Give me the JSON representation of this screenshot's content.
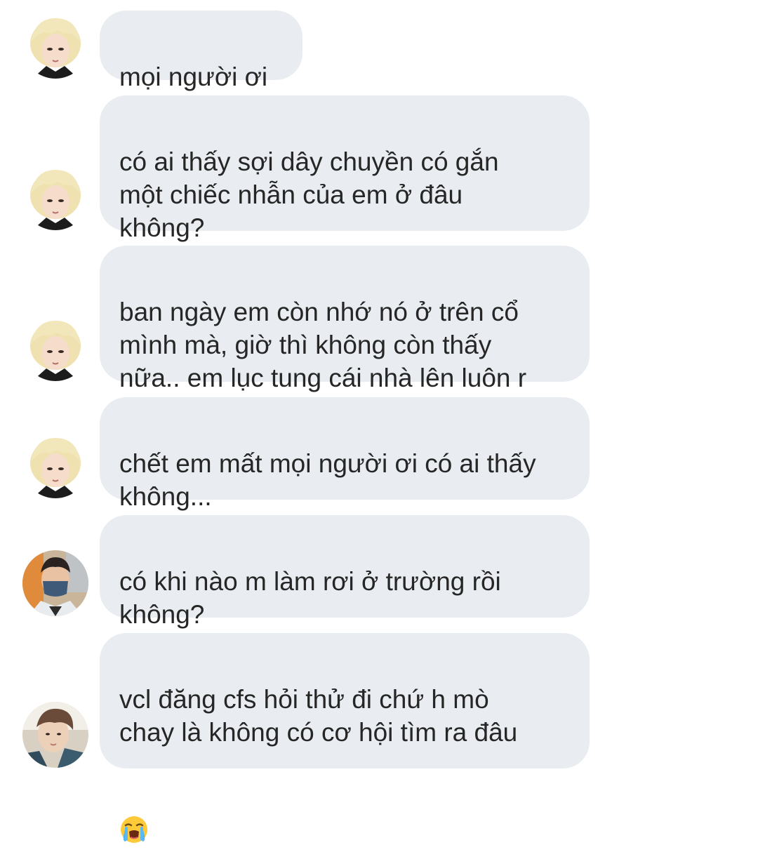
{
  "conversation": {
    "messages": [
      {
        "sender": "user-a",
        "text": "mọi người ơi"
      },
      {
        "sender": "user-a",
        "text": "có ai thấy sợi dây chuyền có gắn\nmột chiếc nhẫn của em ở đâu\nkhông?"
      },
      {
        "sender": "user-a",
        "text": "ban ngày em còn nhớ nó ở trên cổ\nmình mà, giờ thì không còn thấy\nnữa.. em lục tung cái nhà lên luôn r"
      },
      {
        "sender": "user-a",
        "text": "chết em mất mọi người ơi có ai thấy\nkhông..."
      },
      {
        "sender": "user-b",
        "text": "có khi nào m làm rơi ở trường rồi\nkhông?"
      },
      {
        "sender": "user-c",
        "text": "vcl đăng cfs hỏi thử đi chứ h mò\nchay là không có cơ hội tìm ra đâu",
        "emoji": "loudly-crying-face-icon"
      }
    ]
  },
  "colors": {
    "bubble_bg": "#e9edf1",
    "text": "#262626",
    "background": "#ffffff"
  }
}
